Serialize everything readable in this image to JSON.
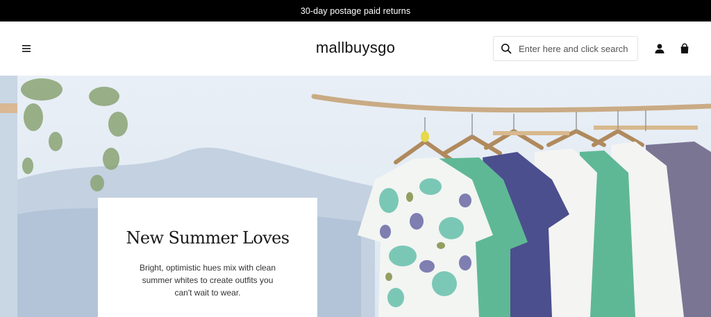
{
  "announcement": {
    "text": "30-day postage paid returns"
  },
  "header": {
    "logo": "mallbuysgo",
    "search": {
      "placeholder": "Enter here and click search",
      "value": ""
    },
    "icons": [
      "hamburger-menu-icon",
      "search-icon",
      "account-icon",
      "shopping-bag-icon"
    ]
  },
  "hero": {
    "title": "New Summer Loves",
    "subtitle": "Bright, optimistic hues mix with clean summer whites to create outfits you can't wait to wear."
  },
  "colors": {
    "announce_bg": "#000000",
    "sky": "#e7eef6",
    "mountain": "#b9c9db",
    "teal": "#5fb895",
    "navy": "#4b4f8e",
    "white_garment": "#f4f4f2",
    "purple_pants": "#7b7594"
  }
}
